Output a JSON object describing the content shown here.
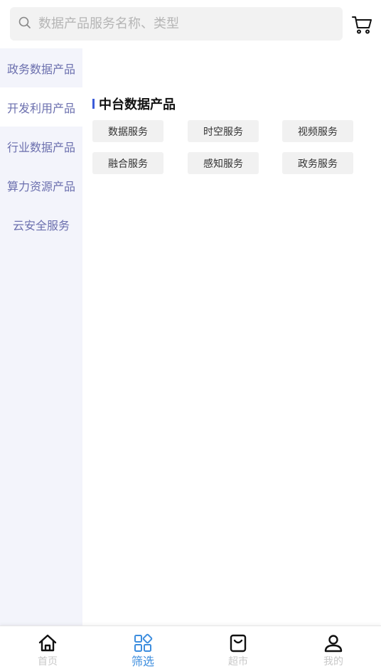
{
  "search": {
    "placeholder": "数据产品服务名称、类型"
  },
  "sidebar": {
    "items": [
      {
        "label": "政务数据产品"
      },
      {
        "label": "开发利用产品"
      },
      {
        "label": "行业数据产品"
      },
      {
        "label": "算力资源产品"
      },
      {
        "label": "云安全服务"
      }
    ],
    "active_index": 1
  },
  "main": {
    "section_title": "中台数据产品",
    "tags": [
      {
        "label": "数据服务"
      },
      {
        "label": "时空服务"
      },
      {
        "label": "视频服务"
      },
      {
        "label": "融合服务"
      },
      {
        "label": "感知服务"
      },
      {
        "label": "政务服务"
      }
    ]
  },
  "bottom_nav": {
    "items": [
      {
        "label": "首页",
        "icon": "home-icon"
      },
      {
        "label": "筛选",
        "icon": "grid-icon"
      },
      {
        "label": "超市",
        "icon": "bag-icon"
      },
      {
        "label": "我的",
        "icon": "user-icon"
      }
    ],
    "active_index": 1
  },
  "colors": {
    "accent": "#3c8dde",
    "sidebar_bg": "#f3f4fb",
    "sidebar_text": "#6b6fae",
    "title_bar": "#3b5bd9"
  }
}
